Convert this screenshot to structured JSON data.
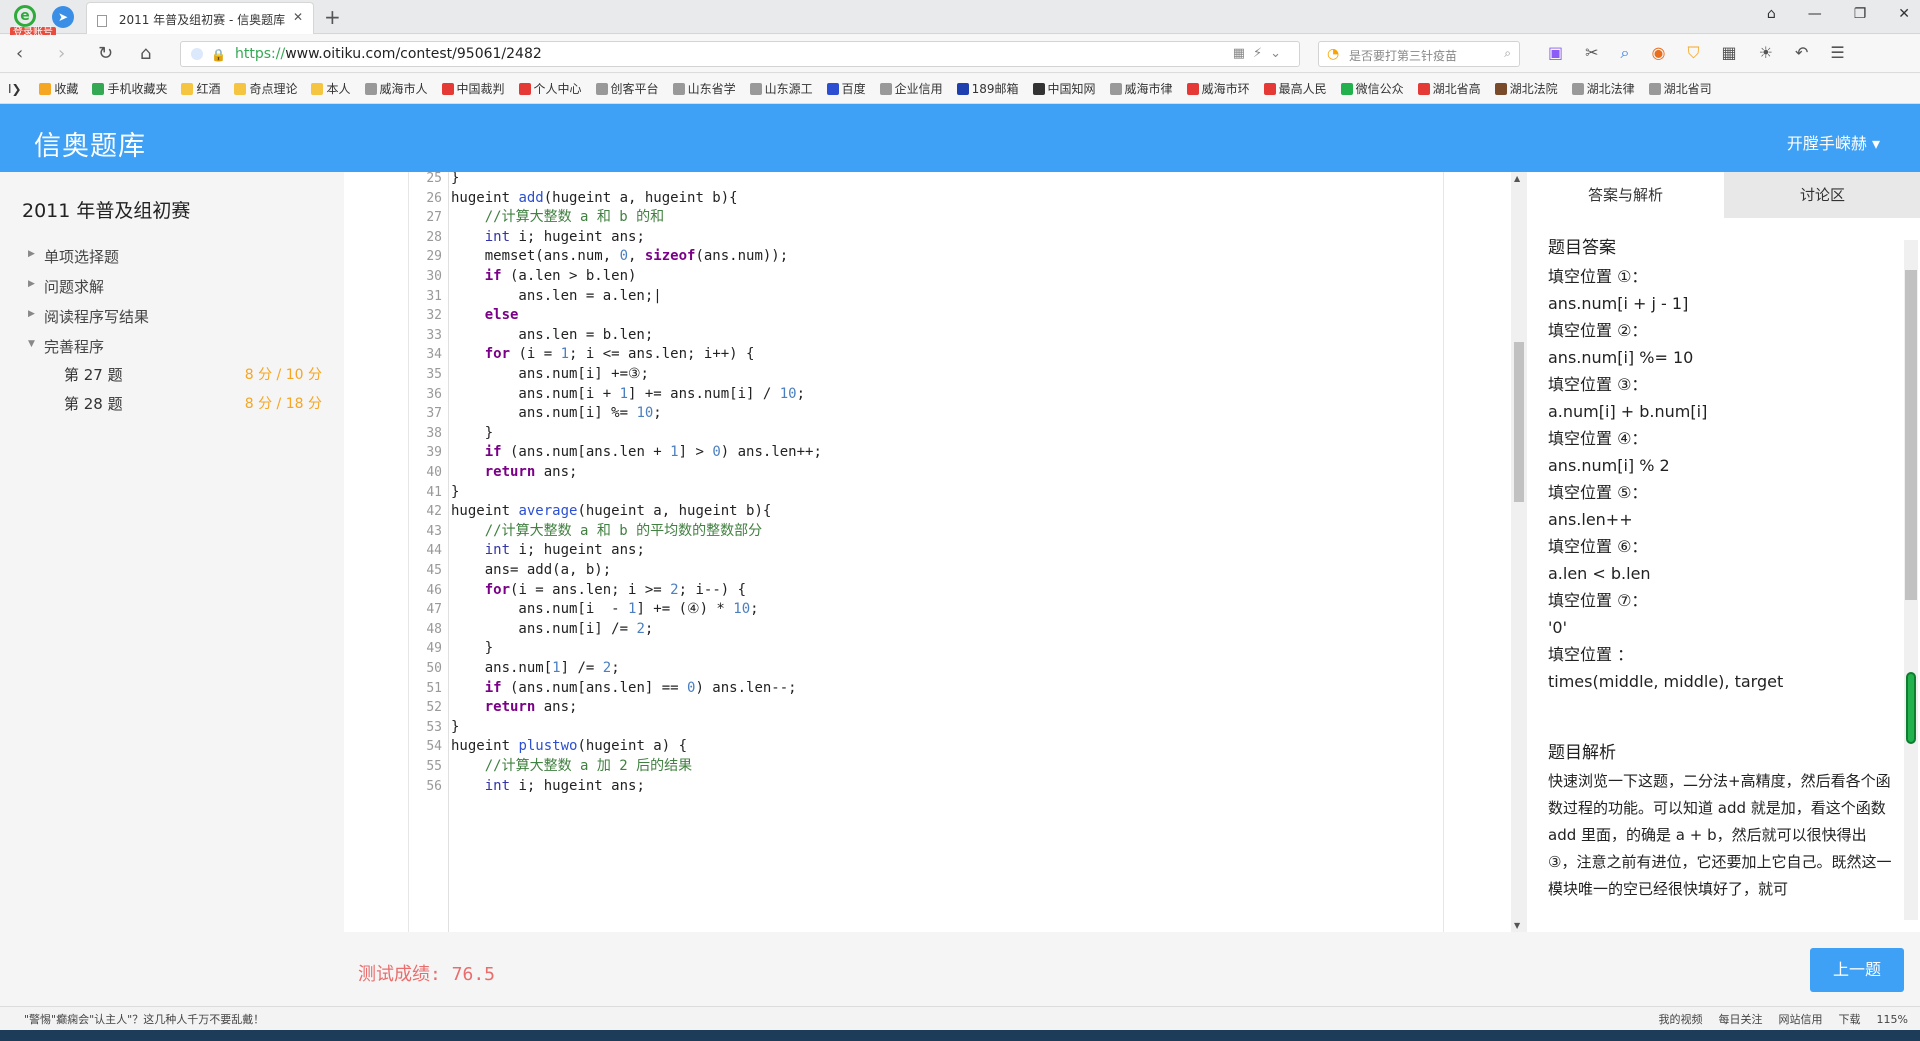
{
  "browser": {
    "login_badge": "登录账号",
    "tab_title": "2011 年普及组初赛 - 信奥题库",
    "url_scheme": "https://",
    "url_rest": "www.oitiku.com/contest/95061/2482",
    "search_placeholder": "是否要打第三针疫苗",
    "bookmarks": [
      "收藏",
      "手机收藏夹",
      "红酒",
      "奇点理论",
      "本人",
      "威海市人",
      "中国裁判",
      "个人中心",
      "创客平台",
      "山东省学",
      "山东源工",
      "百度",
      "企业信用",
      "189邮箱",
      "中国知网",
      "威海市律",
      "威海市环",
      "最高人民",
      "微信公众",
      "湖北省高",
      "湖北法院",
      "湖北法律",
      "湖北省司"
    ]
  },
  "header": {
    "logo": "信奥题库",
    "user": "开膛手嵘赫 ▾"
  },
  "sidebar": {
    "contest_title": "2011 年普及组初赛",
    "sections": [
      "单项选择题",
      "问题求解",
      "阅读程序写结果",
      "完善程序"
    ],
    "questions": [
      {
        "label": "第 27 题",
        "score": "8 分 / 10 分"
      },
      {
        "label": "第 28 题",
        "score": "8 分 / 18 分"
      }
    ]
  },
  "code": {
    "lines": [
      {
        "n": "25",
        "html": "}"
      },
      {
        "n": "26",
        "html": "hugeint <span class='fn'>add</span>(hugeint a, hugeint b){"
      },
      {
        "n": "27",
        "html": "    <span class='cm'>//计算大整数 a 和 b 的和</span>"
      },
      {
        "n": "28",
        "html": "    <span class='typ'>int</span> i; hugeint ans;"
      },
      {
        "n": "29",
        "html": "    memset(ans.num, <span class='numl'>0</span>, <span class='kw'>sizeof</span>(ans.num));"
      },
      {
        "n": "30",
        "html": "    <span class='kw'>if</span> (a.len &gt; b.len)"
      },
      {
        "n": "31",
        "html": "        ans.len = a.len;|"
      },
      {
        "n": "32",
        "html": "    <span class='kw'>else</span>"
      },
      {
        "n": "33",
        "html": "        ans.len = b.len;"
      },
      {
        "n": "34",
        "html": "    <span class='kw'>for</span> (i = <span class='numl'>1</span>; i &lt;= ans.len; i++) {"
      },
      {
        "n": "35",
        "html": "        ans.num[i] +=③;"
      },
      {
        "n": "36",
        "html": "        ans.num[i + <span class='numl'>1</span>] += ans.num[i] / <span class='numl'>10</span>;"
      },
      {
        "n": "37",
        "html": "        ans.num[i] %= <span class='numl'>10</span>;"
      },
      {
        "n": "38",
        "html": "    }"
      },
      {
        "n": "39",
        "html": "    <span class='kw'>if</span> (ans.num[ans.len + <span class='numl'>1</span>] &gt; <span class='numl'>0</span>) ans.len++;"
      },
      {
        "n": "40",
        "html": "    <span class='kw'>return</span> ans;"
      },
      {
        "n": "41",
        "html": "}"
      },
      {
        "n": "42",
        "html": "hugeint <span class='fn'>average</span>(hugeint a, hugeint b){"
      },
      {
        "n": "43",
        "html": "    <span class='cm'>//计算大整数 a 和 b 的平均数的整数部分</span>"
      },
      {
        "n": "44",
        "html": "    <span class='typ'>int</span> i; hugeint ans;"
      },
      {
        "n": "45",
        "html": "    ans= add(a, b);"
      },
      {
        "n": "46",
        "html": "    <span class='kw'>for</span>(i = ans.len; i &gt;= <span class='numl'>2</span>; i--) {"
      },
      {
        "n": "47",
        "html": "        ans.num[i  - <span class='numl'>1</span>] += (④) * <span class='numl'>10</span>;"
      },
      {
        "n": "48",
        "html": "        ans.num[i] /= <span class='numl'>2</span>;"
      },
      {
        "n": "49",
        "html": "    }"
      },
      {
        "n": "50",
        "html": "    ans.num[<span class='numl'>1</span>] /= <span class='numl'>2</span>;"
      },
      {
        "n": "51",
        "html": "    <span class='kw'>if</span> (ans.num[ans.len] == <span class='numl'>0</span>) ans.len--;"
      },
      {
        "n": "52",
        "html": "    <span class='kw'>return</span> ans;"
      },
      {
        "n": "53",
        "html": "}"
      },
      {
        "n": "54",
        "html": "hugeint <span class='fn'>plustwo</span>(hugeint a) {"
      },
      {
        "n": "55",
        "html": "    <span class='cm'>//计算大整数 a 加 2 后的结果</span>"
      },
      {
        "n": "56",
        "html": "    <span class='typ'>int</span> i; hugeint ans;"
      }
    ]
  },
  "answer_panel": {
    "tab_answer": "答案与解析",
    "tab_discuss": "讨论区",
    "answer_heading": "题目答案",
    "answers": [
      {
        "label": "填空位置 ①：",
        "value": "ans.num[i + j - 1]"
      },
      {
        "label": "填空位置 ②：",
        "value": "ans.num[i] %= 10"
      },
      {
        "label": "填空位置 ③：",
        "value": "a.num[i] + b.num[i]"
      },
      {
        "label": "填空位置 ④：",
        "value": "ans.num[i] % 2"
      },
      {
        "label": "填空位置 ⑤：",
        "value": "ans.len++"
      },
      {
        "label": "填空位置 ⑥：",
        "value": "a.len < b.len"
      },
      {
        "label": "填空位置 ⑦：",
        "value": "'0'"
      },
      {
        "label": "填空位置 ：",
        "value": "times(middle, middle), target"
      }
    ],
    "explain_heading": "题目解析",
    "explain_text": "快速浏览一下这题，二分法+高精度，然后看各个函数过程的功能。可以知道 add 就是加，看这个函数 add 里面，的确是 a + b，然后就可以很快得出 ③，注意之前有进位，它还要加上它自己。既然这一模块唯一的空已经很快填好了，就可"
  },
  "footer": {
    "score_text": "测试成绩: 76.5",
    "prev_button": "上一题"
  },
  "statusbar": {
    "news": "\"警惕\"癫痫会\"认主人\"？这几种人千万不要乱戴！",
    "items": [
      "我的视频",
      "每日关注",
      "网站信用",
      "下载",
      "115%"
    ]
  }
}
